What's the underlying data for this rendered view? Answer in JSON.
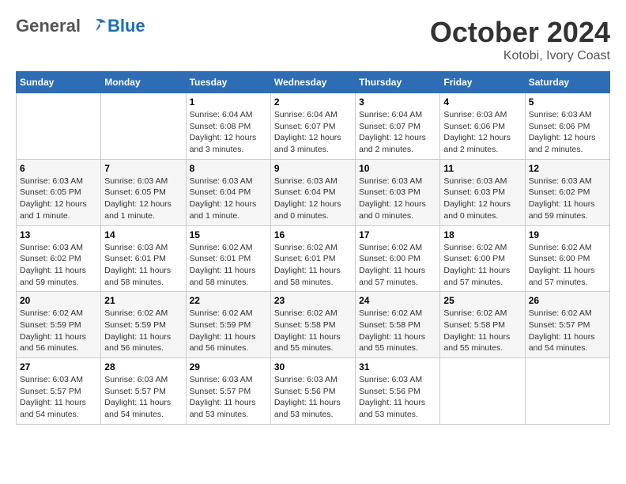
{
  "header": {
    "logo": {
      "general": "General",
      "blue": "Blue"
    },
    "title": "October 2024",
    "location": "Kotobi, Ivory Coast"
  },
  "calendar": {
    "days_of_week": [
      "Sunday",
      "Monday",
      "Tuesday",
      "Wednesday",
      "Thursday",
      "Friday",
      "Saturday"
    ],
    "weeks": [
      [
        {
          "day": null,
          "info": null
        },
        {
          "day": null,
          "info": null
        },
        {
          "day": "1",
          "info": "Sunrise: 6:04 AM\nSunset: 6:08 PM\nDaylight: 12 hours\nand 3 minutes."
        },
        {
          "day": "2",
          "info": "Sunrise: 6:04 AM\nSunset: 6:07 PM\nDaylight: 12 hours\nand 3 minutes."
        },
        {
          "day": "3",
          "info": "Sunrise: 6:04 AM\nSunset: 6:07 PM\nDaylight: 12 hours\nand 2 minutes."
        },
        {
          "day": "4",
          "info": "Sunrise: 6:03 AM\nSunset: 6:06 PM\nDaylight: 12 hours\nand 2 minutes."
        },
        {
          "day": "5",
          "info": "Sunrise: 6:03 AM\nSunset: 6:06 PM\nDaylight: 12 hours\nand 2 minutes."
        }
      ],
      [
        {
          "day": "6",
          "info": "Sunrise: 6:03 AM\nSunset: 6:05 PM\nDaylight: 12 hours\nand 1 minute."
        },
        {
          "day": "7",
          "info": "Sunrise: 6:03 AM\nSunset: 6:05 PM\nDaylight: 12 hours\nand 1 minute."
        },
        {
          "day": "8",
          "info": "Sunrise: 6:03 AM\nSunset: 6:04 PM\nDaylight: 12 hours\nand 1 minute."
        },
        {
          "day": "9",
          "info": "Sunrise: 6:03 AM\nSunset: 6:04 PM\nDaylight: 12 hours\nand 0 minutes."
        },
        {
          "day": "10",
          "info": "Sunrise: 6:03 AM\nSunset: 6:03 PM\nDaylight: 12 hours\nand 0 minutes."
        },
        {
          "day": "11",
          "info": "Sunrise: 6:03 AM\nSunset: 6:03 PM\nDaylight: 12 hours\nand 0 minutes."
        },
        {
          "day": "12",
          "info": "Sunrise: 6:03 AM\nSunset: 6:02 PM\nDaylight: 11 hours\nand 59 minutes."
        }
      ],
      [
        {
          "day": "13",
          "info": "Sunrise: 6:03 AM\nSunset: 6:02 PM\nDaylight: 11 hours\nand 59 minutes."
        },
        {
          "day": "14",
          "info": "Sunrise: 6:03 AM\nSunset: 6:01 PM\nDaylight: 11 hours\nand 58 minutes."
        },
        {
          "day": "15",
          "info": "Sunrise: 6:02 AM\nSunset: 6:01 PM\nDaylight: 11 hours\nand 58 minutes."
        },
        {
          "day": "16",
          "info": "Sunrise: 6:02 AM\nSunset: 6:01 PM\nDaylight: 11 hours\nand 58 minutes."
        },
        {
          "day": "17",
          "info": "Sunrise: 6:02 AM\nSunset: 6:00 PM\nDaylight: 11 hours\nand 57 minutes."
        },
        {
          "day": "18",
          "info": "Sunrise: 6:02 AM\nSunset: 6:00 PM\nDaylight: 11 hours\nand 57 minutes."
        },
        {
          "day": "19",
          "info": "Sunrise: 6:02 AM\nSunset: 6:00 PM\nDaylight: 11 hours\nand 57 minutes."
        }
      ],
      [
        {
          "day": "20",
          "info": "Sunrise: 6:02 AM\nSunset: 5:59 PM\nDaylight: 11 hours\nand 56 minutes."
        },
        {
          "day": "21",
          "info": "Sunrise: 6:02 AM\nSunset: 5:59 PM\nDaylight: 11 hours\nand 56 minutes."
        },
        {
          "day": "22",
          "info": "Sunrise: 6:02 AM\nSunset: 5:59 PM\nDaylight: 11 hours\nand 56 minutes."
        },
        {
          "day": "23",
          "info": "Sunrise: 6:02 AM\nSunset: 5:58 PM\nDaylight: 11 hours\nand 55 minutes."
        },
        {
          "day": "24",
          "info": "Sunrise: 6:02 AM\nSunset: 5:58 PM\nDaylight: 11 hours\nand 55 minutes."
        },
        {
          "day": "25",
          "info": "Sunrise: 6:02 AM\nSunset: 5:58 PM\nDaylight: 11 hours\nand 55 minutes."
        },
        {
          "day": "26",
          "info": "Sunrise: 6:02 AM\nSunset: 5:57 PM\nDaylight: 11 hours\nand 54 minutes."
        }
      ],
      [
        {
          "day": "27",
          "info": "Sunrise: 6:03 AM\nSunset: 5:57 PM\nDaylight: 11 hours\nand 54 minutes."
        },
        {
          "day": "28",
          "info": "Sunrise: 6:03 AM\nSunset: 5:57 PM\nDaylight: 11 hours\nand 54 minutes."
        },
        {
          "day": "29",
          "info": "Sunrise: 6:03 AM\nSunset: 5:57 PM\nDaylight: 11 hours\nand 53 minutes."
        },
        {
          "day": "30",
          "info": "Sunrise: 6:03 AM\nSunset: 5:56 PM\nDaylight: 11 hours\nand 53 minutes."
        },
        {
          "day": "31",
          "info": "Sunrise: 6:03 AM\nSunset: 5:56 PM\nDaylight: 11 hours\nand 53 minutes."
        },
        {
          "day": null,
          "info": null
        },
        {
          "day": null,
          "info": null
        }
      ]
    ]
  }
}
